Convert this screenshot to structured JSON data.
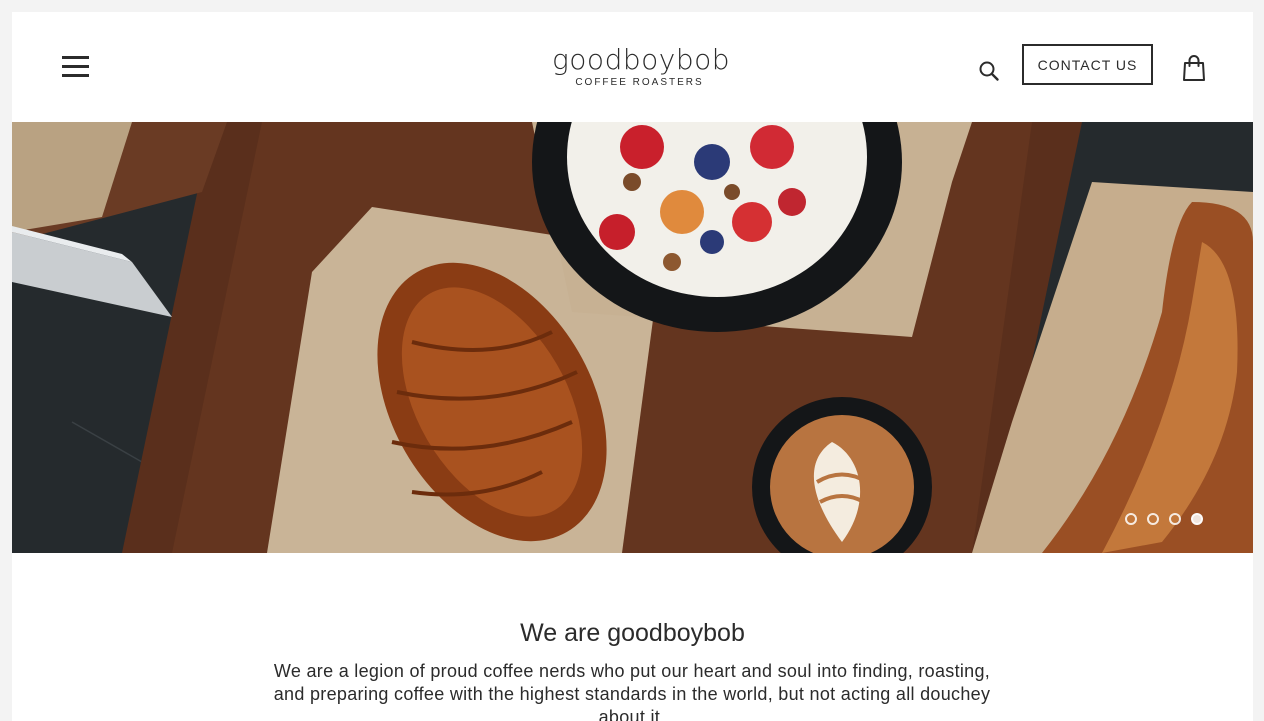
{
  "header": {
    "logo_main": "goodboybob",
    "logo_sub": "COFFEE ROASTERS",
    "contact_label": "CONTACT US",
    "icons": {
      "menu": "hamburger-menu-icon",
      "search": "search-icon",
      "cart": "shopping-bag-icon"
    }
  },
  "hero": {
    "description": "",
    "slides": 4,
    "active_slide": 4
  },
  "intro": {
    "title": "We are goodboybob",
    "text": "We are a legion of proud coffee nerds who put our heart and soul into finding, roasting, and preparing coffee with the highest standards in the world, but not acting all douchey about it."
  },
  "colors": {
    "text": "#2b2b2b",
    "background": "#ffffff",
    "page_bg": "#f3f3f3"
  }
}
